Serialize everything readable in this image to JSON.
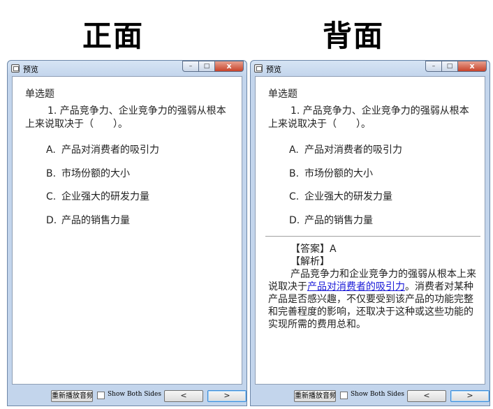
{
  "labels": {
    "front": "正面",
    "back": "背面"
  },
  "window": {
    "title": "预览",
    "minimize": "–",
    "maximize": "□",
    "close": "x"
  },
  "question": {
    "type": "单选题",
    "text": "1. 产品竞争力、企业竞争力的强弱从根本上来说取决于（　　）。",
    "options": [
      {
        "letter": "A.",
        "text": "产品对消费者的吸引力"
      },
      {
        "letter": "B.",
        "text": "市场份额的大小"
      },
      {
        "letter": "C.",
        "text": "企业强大的研发力量"
      },
      {
        "letter": "D.",
        "text": "产品的销售力量"
      }
    ]
  },
  "answer": {
    "answer_line": "【答案】A",
    "analysis_label": "【解析】",
    "analysis_before": "产品竞争力和企业竞争力的强弱从根本上来说取决于",
    "analysis_link": "产品对消费者的吸引力",
    "analysis_after": "。消费者对某种产品是否感兴趣，不仅要受到该产品的功能完整和完善程度的影响，还取决于这种或这些功能的实现所需的费用总和。"
  },
  "toolbar": {
    "replay_audio": "重新播放音频",
    "show_both_sides": "Show Both Sides",
    "prev": "<",
    "next": ">"
  }
}
